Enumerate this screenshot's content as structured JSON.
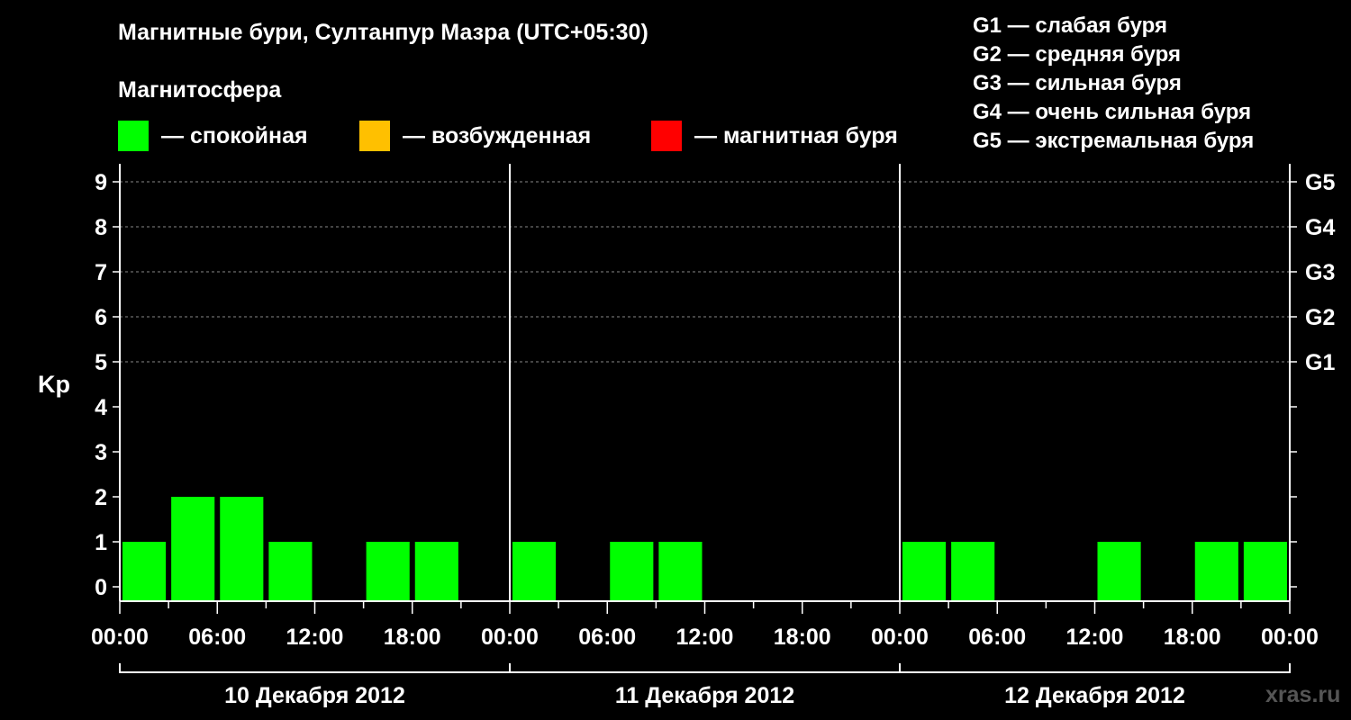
{
  "title": "Магнитные бури, Султанпур Мазра (UTC+05:30)",
  "legend": {
    "heading": "Магнитосфера",
    "items": [
      {
        "label": "— спокойная",
        "color": "#00ff00"
      },
      {
        "label": "— возбужденная",
        "color": "#ffc000"
      },
      {
        "label": "— магнитная буря",
        "color": "#ff0000"
      }
    ]
  },
  "g_levels": [
    "G1 — слабая буря",
    "G2 — средняя буря",
    "G3 — сильная буря",
    "G4 — очень сильная буря",
    "G5 — экстремальная буря"
  ],
  "source": "xras.ru",
  "chart_data": {
    "type": "bar",
    "ylabel": "Kp",
    "ylim": [
      0,
      9
    ],
    "y_ticks": [
      "0",
      "1",
      "2",
      "3",
      "4",
      "5",
      "6",
      "7",
      "8",
      "9"
    ],
    "right_axis_ticks": [
      {
        "kp": 5,
        "label": "G1"
      },
      {
        "kp": 6,
        "label": "G2"
      },
      {
        "kp": 7,
        "label": "G3"
      },
      {
        "kp": 8,
        "label": "G4"
      },
      {
        "kp": 9,
        "label": "G5"
      }
    ],
    "x_tick_labels": [
      "00:00",
      "06:00",
      "12:00",
      "18:00",
      "00:00",
      "06:00",
      "12:00",
      "18:00",
      "00:00",
      "06:00",
      "12:00",
      "18:00",
      "00:00"
    ],
    "days": [
      "10 Декабря 2012",
      "11 Декабря 2012",
      "12 Декабря 2012"
    ],
    "interval_hours": 3,
    "categories": [
      "10.12 00:00",
      "10.12 03:00",
      "10.12 06:00",
      "10.12 09:00",
      "10.12 12:00",
      "10.12 15:00",
      "10.12 18:00",
      "10.12 21:00",
      "11.12 00:00",
      "11.12 03:00",
      "11.12 06:00",
      "11.12 09:00",
      "11.12 12:00",
      "11.12 15:00",
      "11.12 18:00",
      "11.12 21:00",
      "12.12 00:00",
      "12.12 03:00",
      "12.12 06:00",
      "12.12 09:00",
      "12.12 12:00",
      "12.12 15:00",
      "12.12 18:00",
      "12.12 21:00"
    ],
    "values": [
      1,
      2,
      2,
      1,
      0,
      1,
      1,
      0,
      1,
      0,
      1,
      1,
      0,
      0,
      0,
      0,
      1,
      1,
      0,
      0,
      1,
      0,
      1,
      1
    ],
    "bar_color": "#00ff00",
    "grid": true
  }
}
